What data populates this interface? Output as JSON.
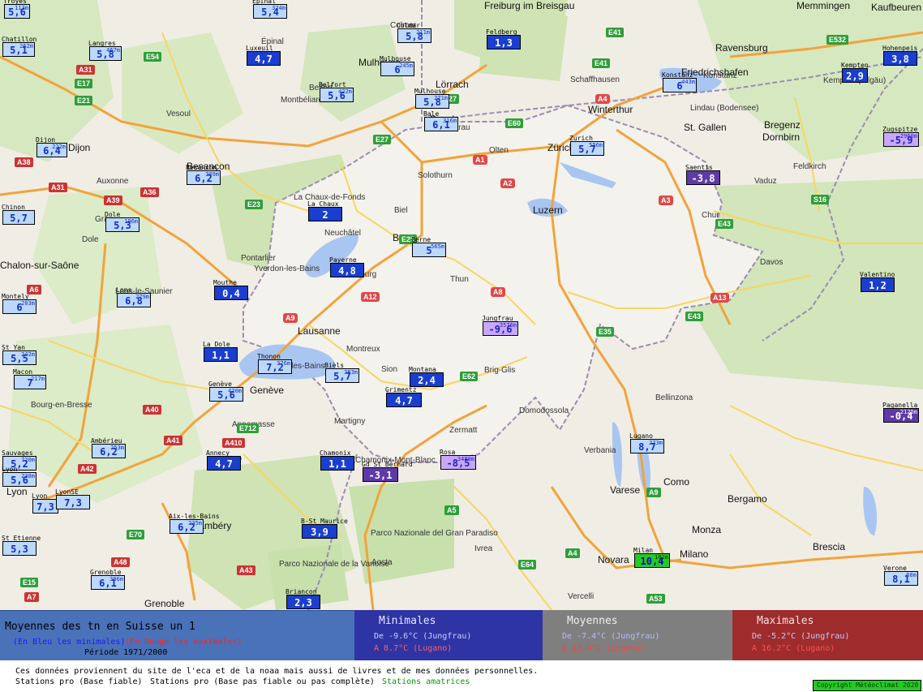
{
  "colors": {
    "min_blue": "#1a3ecf",
    "light_blue": "#bcd8ff",
    "dark_blue": "#2239b8",
    "purple": "#5e3aa8",
    "lilac": "#c8a8ff",
    "green_high": "#22cc22",
    "legend_title_bg": "#4a72b8",
    "legend_min_bg": "#2e34a4",
    "legend_mean_bg": "#7f7f7f",
    "legend_max_bg": "#9e2c2c"
  },
  "map": {
    "places": [
      "Freiburg im Breisgau",
      "Ravensburg",
      "Kaufbeuren",
      "Memmingen",
      "Mulhouse",
      "Lörrach",
      "Basel",
      "Zürich",
      "Winterthur",
      "St. Gallen",
      "Friedrichshafen",
      "Dornbirn",
      "Bregenz",
      "Besançon",
      "Dijon",
      "Chalon-sur-Saône",
      "Bern",
      "Luzern",
      "Lausanne",
      "Genève",
      "Annecy",
      "Lyon",
      "Grenoble",
      "Chambéry",
      "Milano",
      "Monza",
      "Bergamo",
      "Brescia",
      "Como",
      "Varese",
      "Novara",
      "Lugano",
      "Bellinzona",
      "Sion",
      "Montreux",
      "Neuchâtel",
      "La Chaux-de-Fonds",
      "Biel",
      "Solothurn",
      "Olten",
      "Aarau",
      "Thun",
      "Davos",
      "Chur",
      "Vaduz",
      "Feldkirch",
      "Kempten (Allgäu)",
      "Lindau (Bodensee)",
      "Konstanz",
      "Schaffhausen",
      "Vercelli",
      "Ivrea",
      "Aosta",
      "Parco Nazionale del Gran Paradiso",
      "Parco Nazionale de la Vanoise",
      "Bourg-en-Bresse",
      "Mâcon",
      "Lons-le-Saunier",
      "Pontarlier",
      "Yverdon-les-Bains",
      "Fribourg",
      "Thonon-les-Bains",
      "Annemasse",
      "Chamonix-Mont-Blanc",
      "Martigny",
      "Zermatt",
      "Brig-Glis",
      "Domodossola",
      "Verbania",
      "Vesoul",
      "Belfort",
      "Montbéliard",
      "Colmar",
      "Épinal",
      "Langres",
      "Gray",
      "Dole",
      "Auxonne"
    ],
    "shields": [
      "E54",
      "E25",
      "E41",
      "E43",
      "E60",
      "E27",
      "E35",
      "E62",
      "E21",
      "E712",
      "E70",
      "E64",
      "A36",
      "A39",
      "A31",
      "A38",
      "A40",
      "A41",
      "A43",
      "A6",
      "A5",
      "A4",
      "A9",
      "A42",
      "A48",
      "A7",
      "A53",
      "A31",
      "A410",
      "E15",
      "E23",
      "E532",
      "E43",
      "E17",
      "S16",
      "E27",
      "E41",
      "A1",
      "A2",
      "A3",
      "A13",
      "A8",
      "A9",
      "A12",
      "A4",
      "A6"
    ]
  },
  "stations": [
    {
      "name": "Troyes",
      "elev": "113m",
      "temp": "5,6",
      "kind": "light"
    },
    {
      "name": "Epinal",
      "elev": "324m",
      "temp": "5,4",
      "kind": "light"
    },
    {
      "name": "Chatillon",
      "elev": "262m",
      "temp": "5,1",
      "kind": "light"
    },
    {
      "name": "Langres",
      "elev": "467m",
      "temp": "5,8",
      "kind": "light"
    },
    {
      "name": "Luxeuil",
      "elev": "",
      "temp": "4,7",
      "kind": "blue"
    },
    {
      "name": "Colmar",
      "elev": "211m",
      "temp": "5,8",
      "kind": "light"
    },
    {
      "name": "Feldberg",
      "elev": "",
      "temp": "1,3",
      "kind": "blue"
    },
    {
      "name": "Mulhouse",
      "elev": "245m",
      "temp": "6",
      "kind": "light"
    },
    {
      "name": "Belfort",
      "elev": "422m",
      "temp": "5,6",
      "kind": "light"
    },
    {
      "name": "Mulhouse",
      "elev": "271m",
      "temp": "5,8",
      "kind": "light"
    },
    {
      "name": "Bale",
      "elev": "316m",
      "temp": "6,1",
      "kind": "light"
    },
    {
      "name": "Dijon",
      "elev": "222m",
      "temp": "6,4",
      "kind": "light"
    },
    {
      "name": "Besancon",
      "elev": "309m",
      "temp": "6,2",
      "kind": "light"
    },
    {
      "name": "Zurich",
      "elev": "556m",
      "temp": "5,7",
      "kind": "light"
    },
    {
      "name": "Konstanz",
      "elev": "443m",
      "temp": "6",
      "kind": "light"
    },
    {
      "name": "Saentis",
      "elev": "",
      "temp": "-3,8",
      "kind": "purple"
    },
    {
      "name": "Kempten",
      "elev": "",
      "temp": "2,9",
      "kind": "blue"
    },
    {
      "name": "Hohenpeis",
      "elev": "",
      "temp": "3,8",
      "kind": "blue"
    },
    {
      "name": "Zugspitze",
      "elev": "2960m",
      "temp": "-5,9",
      "kind": "lilac"
    },
    {
      "name": "Chinon",
      "elev": "",
      "temp": "5,7",
      "kind": "light"
    },
    {
      "name": "Dole",
      "elev": "196m",
      "temp": "5,3",
      "kind": "light"
    },
    {
      "name": "La Chaux",
      "elev": "",
      "temp": "2",
      "kind": "blue"
    },
    {
      "name": "Berne",
      "elev": "565m",
      "temp": "5",
      "kind": "light"
    },
    {
      "name": "Payerne",
      "elev": "",
      "temp": "4,8",
      "kind": "blue"
    },
    {
      "name": "Mouthe",
      "elev": "",
      "temp": "0,4",
      "kind": "blue"
    },
    {
      "name": "Lons",
      "elev": "279m",
      "temp": "6,8",
      "kind": "light"
    },
    {
      "name": "Montely",
      "elev": "203m",
      "temp": "6",
      "kind": "light"
    },
    {
      "name": "Jungfrau",
      "elev": "3576m",
      "temp": "-9,6",
      "kind": "lilac"
    },
    {
      "name": "Valentino",
      "elev": "",
      "temp": "1,2",
      "kind": "blue"
    },
    {
      "name": "St Yan",
      "elev": "242m",
      "temp": "5,5",
      "kind": "light"
    },
    {
      "name": "Macon",
      "elev": "217m",
      "temp": "7",
      "kind": "light"
    },
    {
      "name": "La Dole",
      "elev": "",
      "temp": "1,1",
      "kind": "blue"
    },
    {
      "name": "Thonon",
      "elev": "376m",
      "temp": "7,2",
      "kind": "light"
    },
    {
      "name": "Bièls",
      "elev": "383m",
      "temp": "5,7",
      "kind": "light"
    },
    {
      "name": "Montana",
      "elev": "",
      "temp": "2,4",
      "kind": "blue"
    },
    {
      "name": "Genève",
      "elev": "420m",
      "temp": "5,6",
      "kind": "light"
    },
    {
      "name": "Grimentz",
      "elev": "",
      "temp": "4,7",
      "kind": "blue"
    },
    {
      "name": "Ambérieu",
      "elev": "253m",
      "temp": "6,2",
      "kind": "light"
    },
    {
      "name": "Paganella",
      "elev": "2125m",
      "temp": "-0,4",
      "kind": "purple"
    },
    {
      "name": "Sauvages",
      "elev": "720m",
      "temp": "5,2",
      "kind": "light"
    },
    {
      "name": "Annecy",
      "elev": "",
      "temp": "4,7",
      "kind": "blue"
    },
    {
      "name": "Chamonix",
      "elev": "",
      "temp": "1,1",
      "kind": "blue"
    },
    {
      "name": "Gd St Bernard",
      "elev": "",
      "temp": "-3,1",
      "kind": "purple"
    },
    {
      "name": "Rosa",
      "elev": "3488m",
      "temp": "-8,5",
      "kind": "lilac"
    },
    {
      "name": "Lugano",
      "elev": "273m",
      "temp": "8,7",
      "kind": "light"
    },
    {
      "name": "Lyon",
      "elev": "238m",
      "temp": "5,6",
      "kind": "light"
    },
    {
      "name": "Lyon",
      "elev": "",
      "temp": "7,3",
      "kind": "light"
    },
    {
      "name": "LyonSE",
      "elev": "",
      "temp": "7,3",
      "kind": "light"
    },
    {
      "name": "Aix-les-Bains",
      "elev": "235m",
      "temp": "6,2",
      "kind": "light"
    },
    {
      "name": "B-St Maurice",
      "elev": "",
      "temp": "3,9",
      "kind": "blue"
    },
    {
      "name": "St Etienne",
      "elev": "",
      "temp": "5,3",
      "kind": "light"
    },
    {
      "name": "Milan",
      "elev": "102m",
      "temp": "10,4",
      "kind": "green"
    },
    {
      "name": "Grenoble",
      "elev": "386m",
      "temp": "6,1",
      "kind": "light"
    },
    {
      "name": "Verone",
      "elev": "68m",
      "temp": "8,1",
      "kind": "light"
    },
    {
      "name": "Briancon",
      "elev": "",
      "temp": "2,3",
      "kind": "blue"
    }
  ],
  "legend": {
    "title": "Moyennes des tn en Suisse un 1",
    "note_blue": "(En Bleu les minimales)",
    "note_red": "(En Rouge les maximales)",
    "period": "Période 1971/2000",
    "min": {
      "head": "Minimales",
      "line1": "De -9.6°C (Jungfrau)",
      "line2": "A 8.7°C (Lugano)"
    },
    "mean": {
      "head": "Moyennes",
      "line1": "De -7.4°C (Jungfrau)",
      "line2": "A 12.4°C (Lugano)"
    },
    "max": {
      "head": "Maximales",
      "line1": "De -5.2°C (Jungfrau)",
      "line2": "A 16.2°C (Lugano)"
    }
  },
  "footer": {
    "source": "Ces données proviennent du site de l'eca et de la noaa mais aussi de livres et de mes données personnelles.",
    "pro_ok": "Stations pro (Base fiable)",
    "pro_unsure": "Stations pro (Base pas fiable ou pas complète)",
    "amateur": "Stations amatrices",
    "copyright": "Copyright Météoclimat 2020"
  }
}
